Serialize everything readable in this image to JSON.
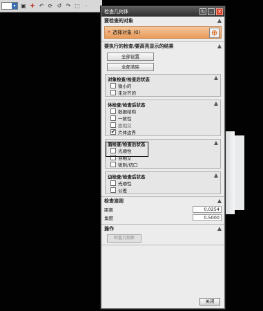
{
  "dialog": {
    "title": "检查几何体",
    "sections": {
      "objects": {
        "header": "要检查的对象",
        "select_label": "选择对象 (0)"
      },
      "checks": {
        "header": "要执行的检查/要高亮显示的结果",
        "set_all": "全部设置",
        "clear_all": "全部清除",
        "object_group": {
          "header": "对象检查/检查后状态",
          "items": [
            {
              "label": "微小的",
              "checked": false
            },
            {
              "label": "未对齐的",
              "checked": false
            }
          ]
        },
        "body_group": {
          "header": "体检查/检查后状态",
          "items": [
            {
              "label": "数据结构",
              "checked": false
            },
            {
              "label": "一致性",
              "checked": false
            },
            {
              "label": "面相交",
              "checked": false
            },
            {
              "label": "片体边界",
              "checked": true
            }
          ]
        },
        "face_group": {
          "header": "面检查/检查后状态",
          "items": [
            {
              "label": "光顺性",
              "checked": false
            },
            {
              "label": "自相交",
              "checked": false
            },
            {
              "label": "锐刺/切口",
              "checked": false
            }
          ]
        },
        "edge_group": {
          "header": "边检查/检查后状态",
          "items": [
            {
              "label": "光顺性",
              "checked": false
            },
            {
              "label": "公差",
              "checked": false
            }
          ]
        }
      },
      "criteria": {
        "header": "检查准则",
        "distance_label": "距离",
        "distance_value": "0.0254",
        "angle_label": "角度",
        "angle_value": "0.5000"
      },
      "operation": {
        "header": "操作",
        "check_button": "检查几何体"
      }
    },
    "close_button": "关闭"
  },
  "icons": {
    "collapse": "▲",
    "check": "✔",
    "crosshair": "⊕"
  }
}
